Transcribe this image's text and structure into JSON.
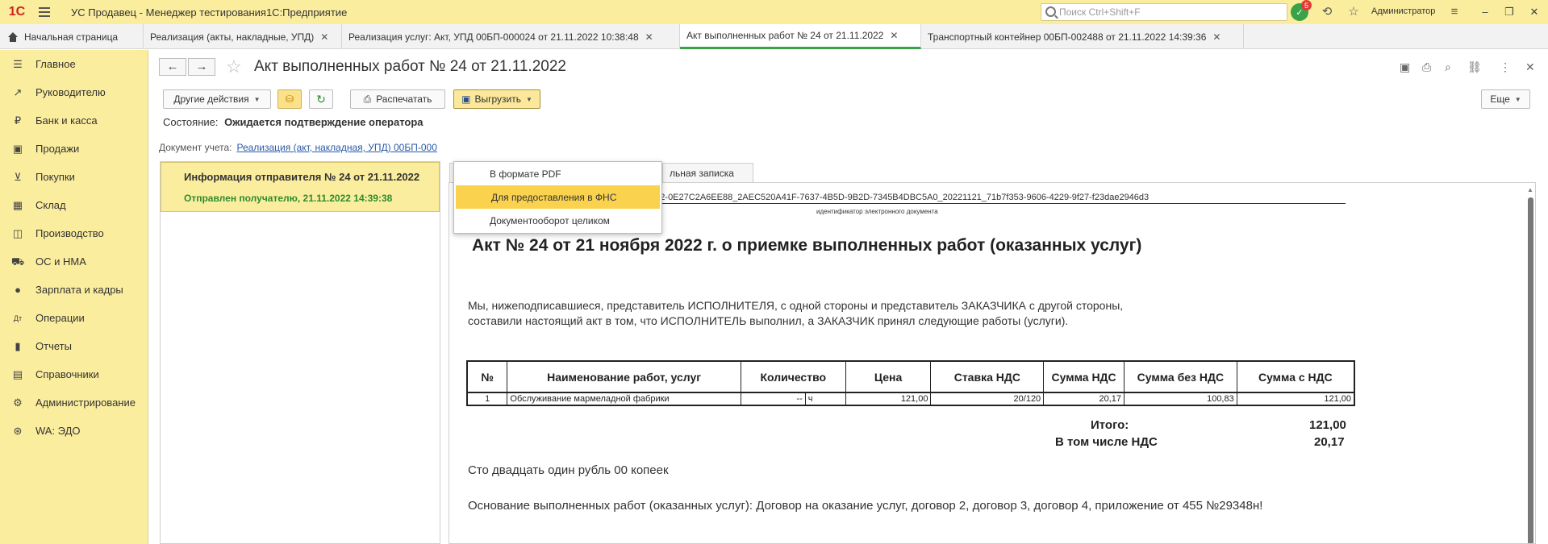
{
  "app": {
    "logo": "1С",
    "title": "УС Продавец  - Менеджер тестирования1С:Предприятие",
    "search_placeholder": "Поиск Ctrl+Shift+F",
    "notifications_count": "5",
    "user": "Администратор"
  },
  "tabs": [
    {
      "label": "Начальная страница"
    },
    {
      "label": "Реализация (акты, накладные, УПД)"
    },
    {
      "label": "Реализация услуг: Акт, УПД 00БП-000024 от 21.11.2022 10:38:48"
    },
    {
      "label": "Акт выполненных работ № 24 от 21.11.2022"
    },
    {
      "label": "Транспортный контейнер 00БП-002488 от 21.11.2022 14:39:36"
    }
  ],
  "sidebar": {
    "items": [
      {
        "label": "Главное",
        "icon": "menu-icon"
      },
      {
        "label": "Руководителю",
        "icon": "chart-line-icon"
      },
      {
        "label": "Банк и касса",
        "icon": "ruble-icon"
      },
      {
        "label": "Продажи",
        "icon": "bag-icon"
      },
      {
        "label": "Покупки",
        "icon": "cart-icon"
      },
      {
        "label": "Склад",
        "icon": "warehouse-icon"
      },
      {
        "label": "Производство",
        "icon": "factory-icon"
      },
      {
        "label": "ОС и НМА",
        "icon": "truck-icon"
      },
      {
        "label": "Зарплата и кадры",
        "icon": "person-icon"
      },
      {
        "label": "Операции",
        "icon": "dt-kt-icon"
      },
      {
        "label": "Отчеты",
        "icon": "bar-chart-icon"
      },
      {
        "label": "Справочники",
        "icon": "book-icon"
      },
      {
        "label": "Администрирование",
        "icon": "gear-icon"
      },
      {
        "label": "WA: ЭДО",
        "icon": "edo-icon"
      }
    ]
  },
  "document": {
    "title": "Акт выполненных работ № 24 от 21.11.2022",
    "toolbar": {
      "other_actions": "Другие действия",
      "print": "Распечатать",
      "export": "Выгрузить",
      "more": "Еще"
    },
    "state_label": "Состояние:",
    "state_value": "Ожидается подтверждение оператора",
    "doc_label": "Документ учета:",
    "doc_link": "Реализация (акт, накладная, УПД) 00БП-000",
    "export_menu": [
      "В формате PDF",
      "Для предоставления в ФНС",
      "Документооборот целиком"
    ],
    "info_title": "Информация отправителя № 24 от 21.11.2022",
    "info_status": "Отправлен получателю, 21.11.2022 14:39:38",
    "doc_tab": "льная записка"
  },
  "act": {
    "doc_id": "DP_REZRUISP_2AE88B6A3E3-B965-4B3F-B8A2-0E27C2A6EE88_2AEC520A41F-7637-4B5D-9B2D-7345B4DBC5A0_20221121_71b7f353-9606-4229-9f27-f23dae2946d3",
    "doc_id_caption": "идентификатор электронного документа",
    "title": "Акт № 24 от 21 ноября 2022 г. о приемке выполненных работ (оказанных услуг)",
    "para1": "Мы, нижеподписавшиеся, представитель ИСПОЛНИТЕЛЯ, с одной стороны и представитель ЗАКАЗЧИКА с другой стороны,",
    "para2": "составили настоящий акт в том, что ИСПОЛНИТЕЛЬ выполнил, а ЗАКАЗЧИК принял следующие работы (услуги).",
    "columns": [
      "№",
      "Наименование работ, услуг",
      "Количество",
      "Цена",
      "Ставка НДС",
      "Сумма НДС",
      "Сумма без НДС",
      "Сумма с НДС"
    ],
    "row": {
      "num": "1",
      "name": "Обслуживание мармеладной фабрики",
      "qty": "--",
      "unit": "ч",
      "price": "121,00",
      "vat_rate": "20/120",
      "vat_sum": "20,17",
      "sum_no_vat": "100,83",
      "sum_with_vat": "121,00"
    },
    "total_label": "Итого:",
    "total_value": "121,00",
    "vat_label": "В том числе НДС",
    "vat_value": "20,17",
    "words": "Сто двадцать один рубль 00 копеек",
    "basis": "Основание выполненных работ (оказанных услуг): Договор на оказание услуг, договор 2, договор 3, договор 4, приложение от 455 №29348н!"
  }
}
